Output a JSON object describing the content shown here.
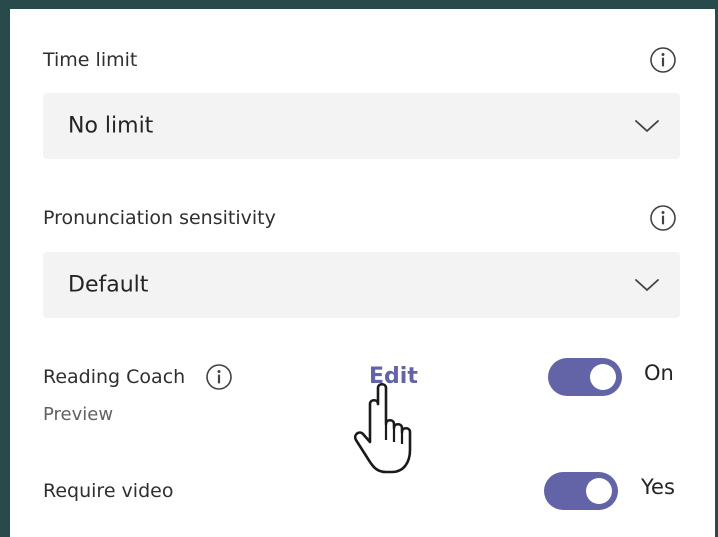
{
  "time_limit": {
    "label": "Time limit",
    "value": "No limit",
    "info_icon": "info-icon",
    "chevron_icon": "chevron-down-icon"
  },
  "pronunciation": {
    "label": "Pronunciation sensitivity",
    "value": "Default",
    "info_icon": "info-icon",
    "chevron_icon": "chevron-down-icon"
  },
  "reading_coach": {
    "label": "Reading Coach",
    "sublabel": "Preview",
    "edit_label": "Edit",
    "state_label": "On",
    "enabled": true,
    "info_icon": "info-icon"
  },
  "require_video": {
    "label": "Require video",
    "state_label": "Yes",
    "enabled": true
  },
  "colors": {
    "accent": "#6264a7",
    "dropdown_bg": "#f3f3f3",
    "frame_border": "#284a4b"
  },
  "cursor_icon": "hand-pointer-icon"
}
